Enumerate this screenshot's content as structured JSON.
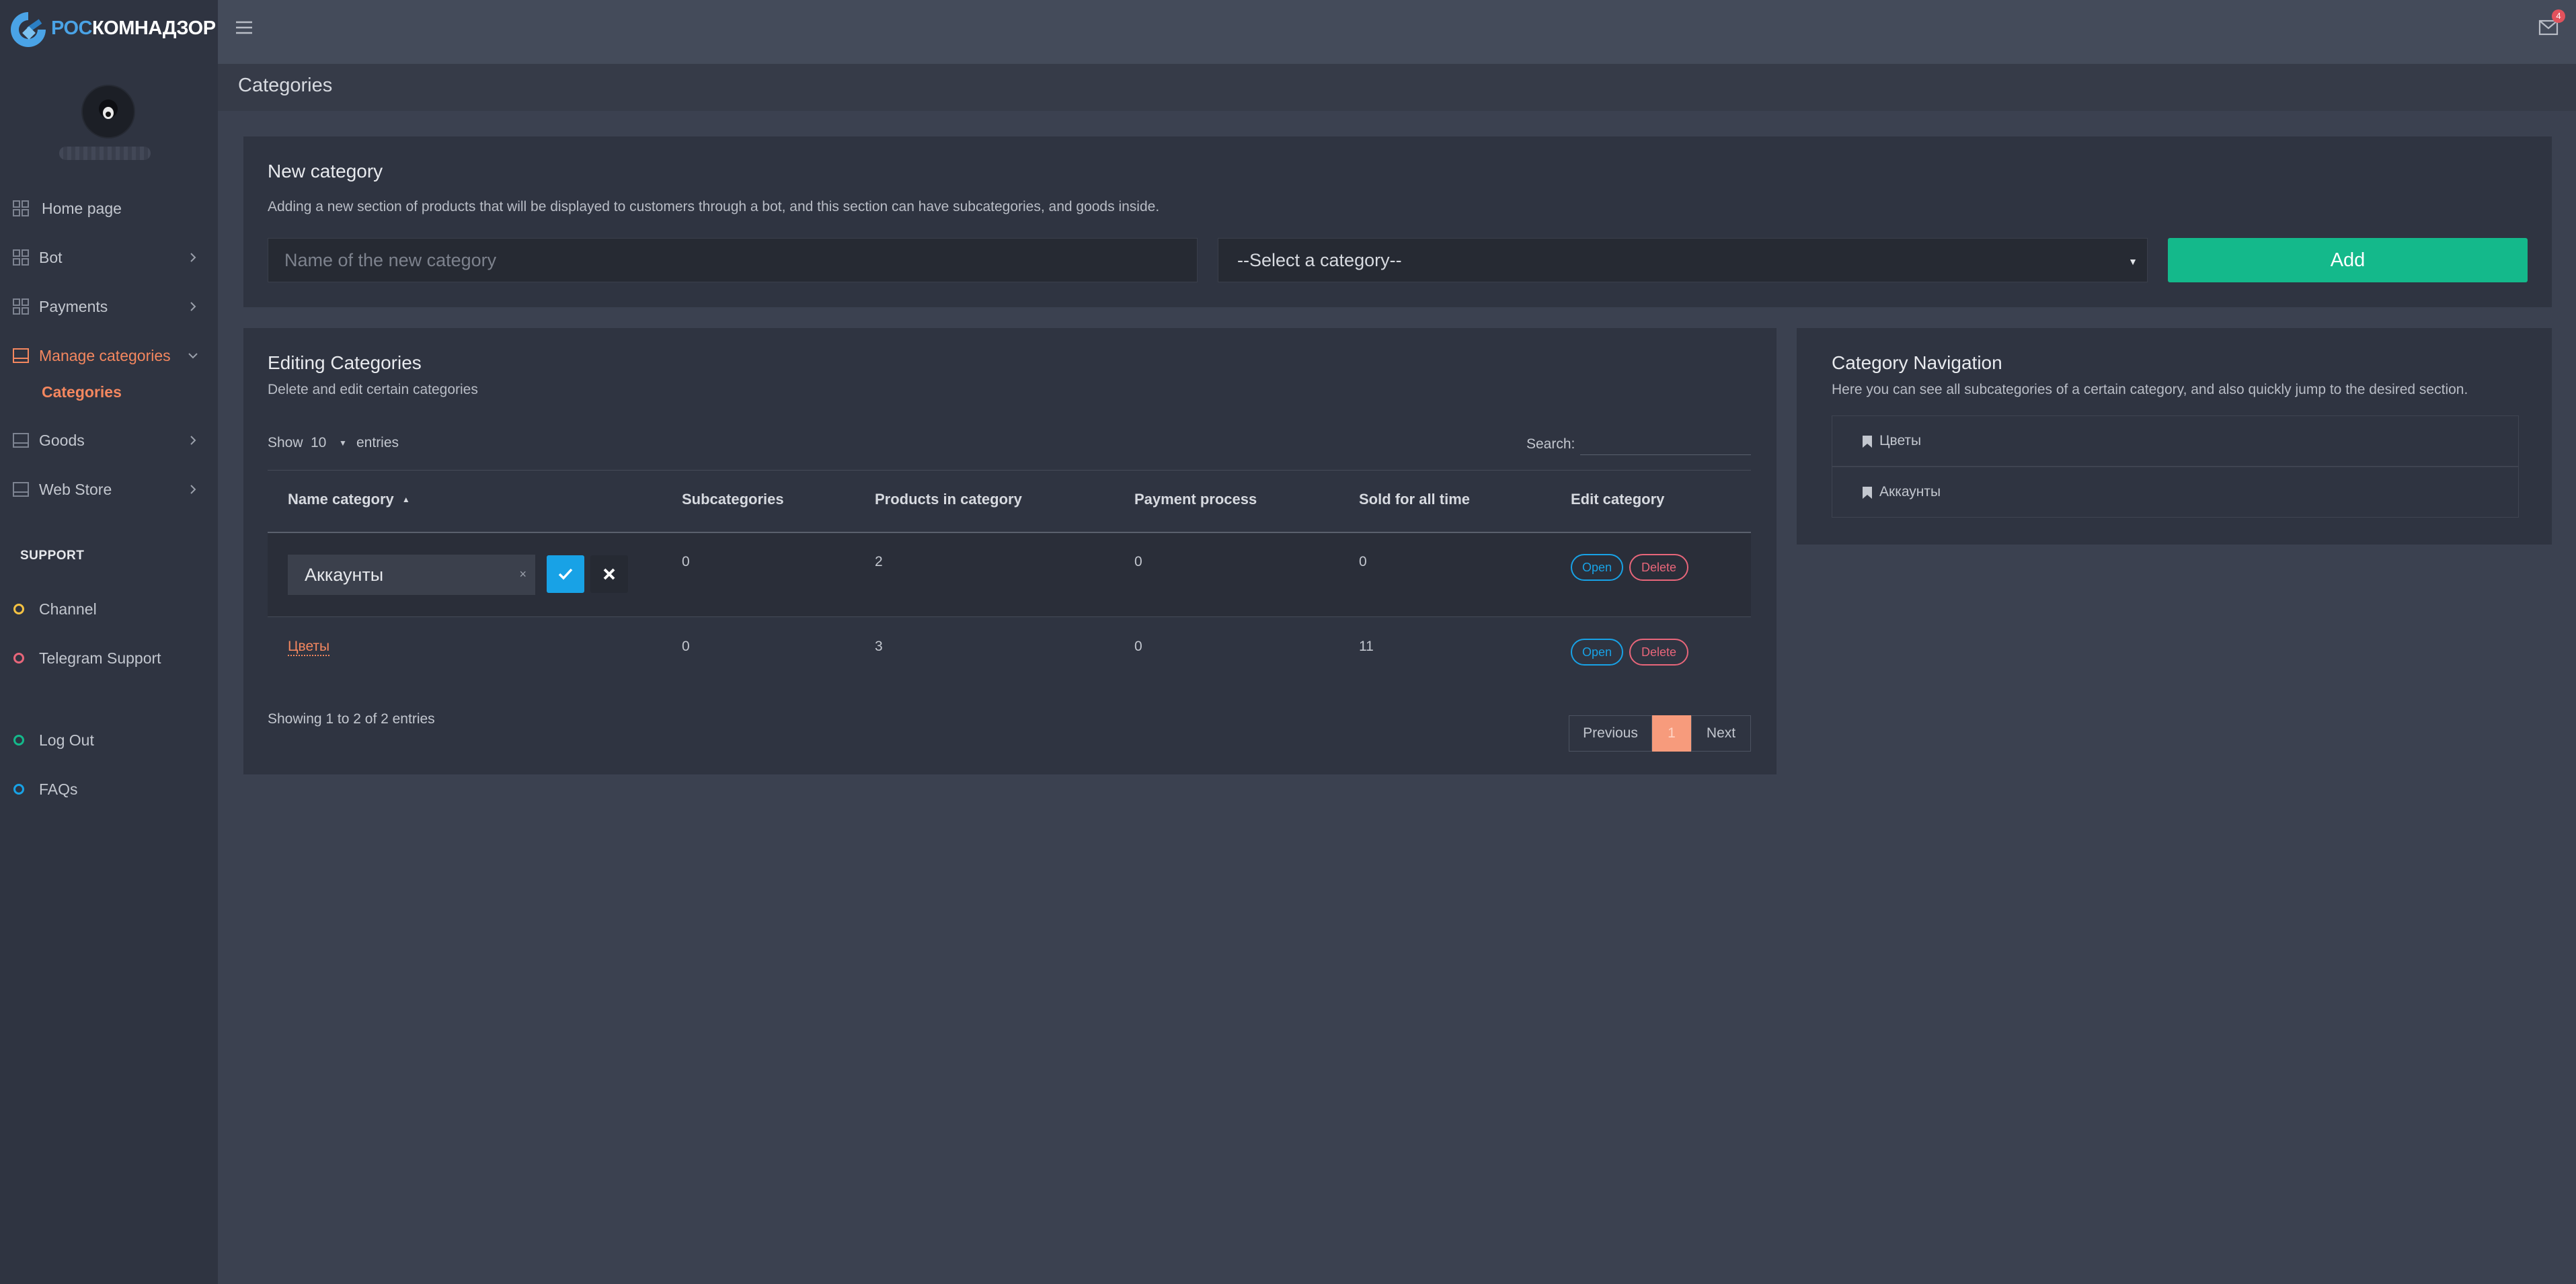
{
  "app": {
    "logo_part1": "РОС",
    "logo_part2": "КОМНАДЗОР",
    "notification_count": "4"
  },
  "sidebar": {
    "items": [
      {
        "label": "Home page"
      },
      {
        "label": "Bot"
      },
      {
        "label": "Payments"
      },
      {
        "label": "Manage categories"
      },
      {
        "label": "Goods"
      },
      {
        "label": "Web Store"
      }
    ],
    "sub_item": "Categories",
    "support_title": "SUPPORT",
    "support_items": [
      {
        "label": "Channel",
        "color": "#f5c242"
      },
      {
        "label": "Telegram Support",
        "color": "#e8667a"
      },
      {
        "label": "Log Out",
        "color": "#14b98b"
      },
      {
        "label": "FAQs",
        "color": "#18a2e6"
      }
    ]
  },
  "breadcrumb": "Categories",
  "new_category": {
    "title": "New category",
    "description": "Adding a new section of products that will be displayed to customers through a bot, and this section can have subcategories, and goods inside.",
    "name_placeholder": "Name of the new category",
    "select_value": "--Select a category--",
    "add_label": "Add"
  },
  "editing": {
    "title": "Editing Categories",
    "description": "Delete and edit certain categories",
    "show_label": "Show",
    "show_value": "10",
    "entries_label": "entries",
    "search_label": "Search:",
    "columns": [
      "Name category",
      "Subcategories",
      "Products in category",
      "Payment process",
      "Sold for all time",
      "Edit category"
    ],
    "rows": [
      {
        "name": "Аккаунты",
        "subcategories": "0",
        "products": "2",
        "payment": "0",
        "sold": "0"
      },
      {
        "name": "Цветы",
        "subcategories": "0",
        "products": "3",
        "payment": "0",
        "sold": "11"
      }
    ],
    "open_label": "Open",
    "delete_label": "Delete",
    "clear_symbol": "×",
    "footer": "Showing 1 to 2 of 2 entries",
    "prev_label": "Previous",
    "page_number": "1",
    "next_label": "Next"
  },
  "navigation": {
    "title": "Category Navigation",
    "description": "Here you can see all subcategories of a certain category, and also quickly jump to the desired section.",
    "items": [
      "Цветы",
      "Аккаунты"
    ]
  },
  "colors": {
    "accent": "#f4875f",
    "add_button": "#14b98b",
    "open": "#18a2e6",
    "delete": "#e8667a"
  }
}
